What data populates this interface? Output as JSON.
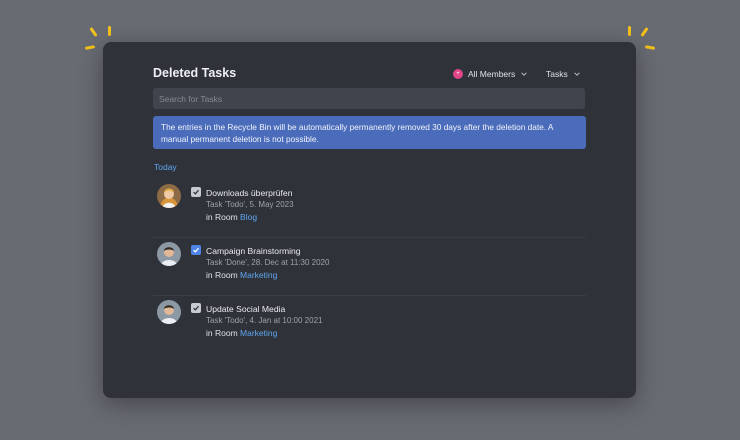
{
  "header": {
    "title": "Deleted Tasks"
  },
  "filters": {
    "members_label": "All Members",
    "members_badge": "+",
    "tasks_label": "Tasks"
  },
  "search": {
    "placeholder": "Search for Tasks",
    "value": ""
  },
  "notice": "The entries in the Recycle Bin will be automatically permanently removed 30 days after the deletion date. A manual permanent deletion is not possible.",
  "section_label": "Today",
  "room_prefix": "in Room",
  "tasks": [
    {
      "name": "Downloads überprüfen",
      "meta": "Task 'Todo', 5. May 2023",
      "room": "Blog",
      "checkbox": "grey"
    },
    {
      "name": "Campaign Brainstorming",
      "meta": "Task 'Done', 28. Dec at 11:30 2020",
      "room": "Marketing",
      "checkbox": "blue"
    },
    {
      "name": "Update Social Media",
      "meta": "Task 'Todo', 4. Jan at 10:00 2021",
      "room": "Marketing",
      "checkbox": "grey"
    }
  ],
  "colors": {
    "background": "#686b72",
    "panel": "#2f3239",
    "notice": "#4b6cba",
    "link": "#5fa6ef",
    "accent_spark": "#f4c21c",
    "member_badge": "#e0458a"
  }
}
